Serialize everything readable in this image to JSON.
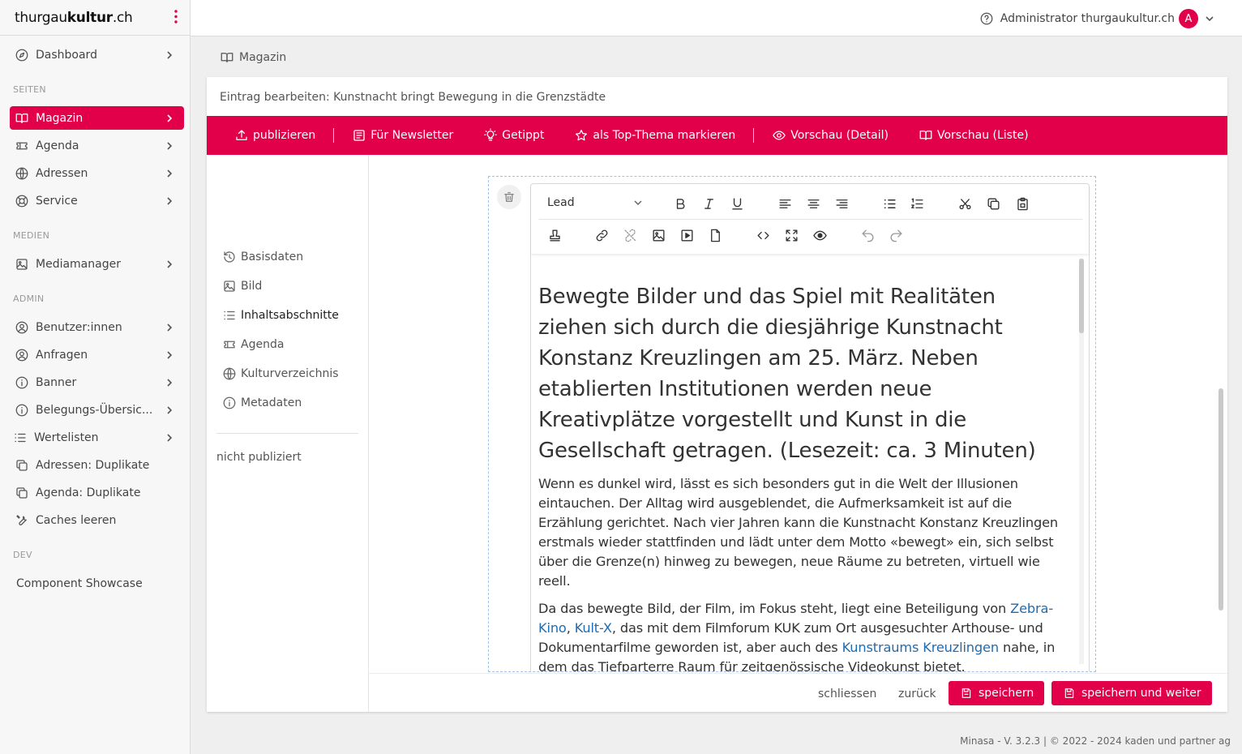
{
  "app": {
    "logo_prefix": "thurgau",
    "logo_bold": "kultur",
    "logo_suffix": ".ch"
  },
  "sidebar": {
    "dashboard": "Dashboard",
    "sections": {
      "seiten": "SEITEN",
      "medien": "MEDIEN",
      "admin": "ADMIN",
      "dev": "DEV"
    },
    "seiten_items": [
      {
        "label": "Magazin",
        "icon": "book-icon"
      },
      {
        "label": "Agenda",
        "icon": "ticket-icon"
      },
      {
        "label": "Adressen",
        "icon": "globe-icon"
      },
      {
        "label": "Service",
        "icon": "lifebuoy-icon"
      }
    ],
    "medien_items": [
      {
        "label": "Mediamanager",
        "icon": "image-icon"
      }
    ],
    "admin_items": [
      {
        "label": "Benutzer:innen",
        "icon": "user-circle-icon"
      },
      {
        "label": "Anfragen",
        "icon": "user-circle-icon"
      },
      {
        "label": "Banner",
        "icon": "info-icon"
      },
      {
        "label": "Belegungs-Übersic...",
        "icon": "info-icon"
      },
      {
        "label": "Wertelisten",
        "icon": "list-icon"
      },
      {
        "label": "Adressen: Duplikate",
        "icon": "copy-icon"
      },
      {
        "label": "Agenda: Duplikate",
        "icon": "copy-icon"
      },
      {
        "label": "Caches leeren",
        "icon": "wrench-icon"
      }
    ],
    "dev_items": [
      {
        "label": "Component Showcase"
      }
    ]
  },
  "header": {
    "user_name": "Administrator thurgaukultur.ch",
    "avatar_initial": "A"
  },
  "breadcrumb": "Magazin",
  "card": {
    "title": "Eintrag bearbeiten: Kunstnacht bringt Bewegung in die Grenzstädte",
    "actions": {
      "publish": "publizieren",
      "newsletter": "Für Newsletter",
      "getippt": "Getippt",
      "top_thema": "als Top-Thema markieren",
      "preview_detail": "Vorschau (Detail)",
      "preview_list": "Vorschau (Liste)"
    },
    "nav": [
      {
        "label": "Basisdaten",
        "icon": "history-icon"
      },
      {
        "label": "Bild",
        "icon": "image-icon"
      },
      {
        "label": "Inhaltsabschnitte",
        "icon": "list-icon"
      },
      {
        "label": "Agenda",
        "icon": "ticket-icon"
      },
      {
        "label": "Kulturverzeichnis",
        "icon": "globe-icon"
      },
      {
        "label": "Metadaten",
        "icon": "info-icon"
      }
    ],
    "status": "nicht publiziert"
  },
  "editor": {
    "format_value": "Lead",
    "lead": "Bewegte Bilder und das Spiel mit Realitäten ziehen sich durch die diesjährige Kunstnacht Konstanz Kreuzlingen am 25. März. Neben etablierten Institutionen werden neue Kreativplätze vorgestellt und Kunst in die Gesellschaft getragen. (Lesezeit: ca. 3 Minuten)",
    "p1": "Wenn es dunkel wird, lässt es sich besonders gut in die Welt der Illusionen eintauchen. Der Alltag wird ausgeblendet, die Aufmerksamkeit ist auf die Erzählung gerichtet. Nach vier Jahren kann die Kunstnacht Konstanz Kreuzlingen erstmals wieder stattfinden und lädt unter dem Motto «bewegt» ein, sich selbst über die Grenze(n) hinweg zu bewegen, neue Räume zu betreten, virtuell wie reell.",
    "p2": {
      "t1": "Da das bewegte Bild, der Film, im Fokus steht, liegt eine Beteiligung von ",
      "link1": "Zebra-Kino",
      "t2": ", ",
      "link2": "Kult-X",
      "t3": ", das mit dem Filmforum KUK zum Ort ausgesuchter Arthouse- und Dokumentarfilme geworden ist, aber auch des ",
      "link3": "Kunstraums Kreuzlingen",
      "t4": " nahe, in dem das Tiefparterre Raum für zeitgenössische Videokunst bietet."
    }
  },
  "bottom": {
    "close": "schliessen",
    "back": "zurück",
    "save": "speichern",
    "save_continue": "speichern und weiter"
  },
  "footer": "Minasa - V. 3.2.3 | © 2022 - 2024 kaden und partner ag",
  "colors": {
    "accent": "#e2004a",
    "link": "#1f6cb0"
  }
}
